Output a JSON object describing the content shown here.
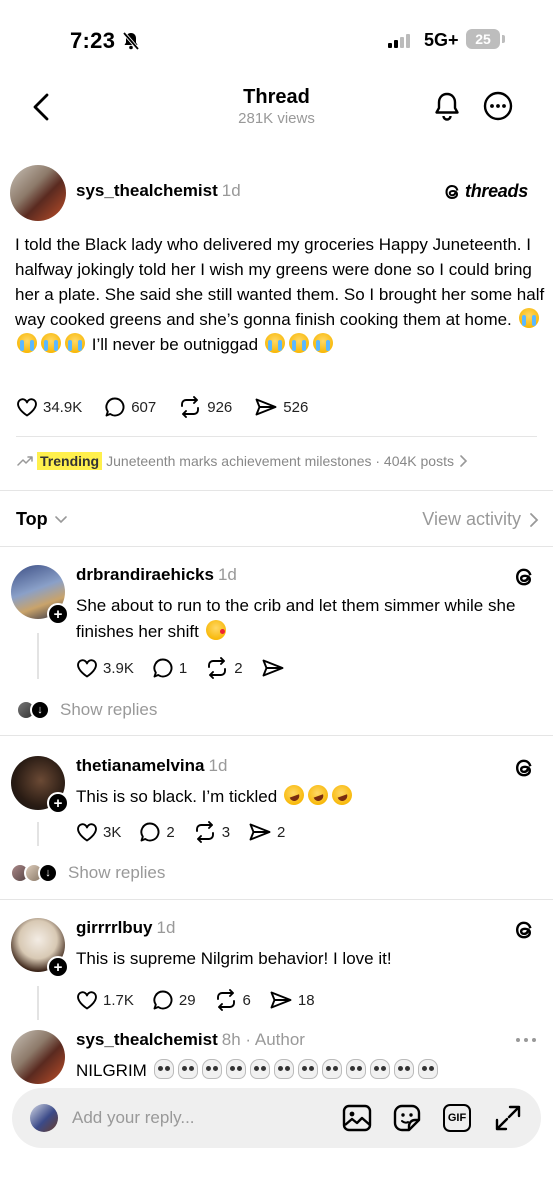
{
  "status_bar": {
    "time": "7:23",
    "network": "5G+",
    "battery": "25"
  },
  "header": {
    "title": "Thread",
    "views": "281K views"
  },
  "post": {
    "username": "sys_thealchemist",
    "age": "1d",
    "brand": "threads",
    "text_1": "I told the Black lady who delivered my groceries Happy Juneteenth. I halfway jokingly told her I wish my greens were done so I could bring her a plate. She said she still wanted them. So I brought her some half way cooked greens and she’s gonna finish cooking them at home.",
    "text_2": "I’ll never be outniggad",
    "likes": "34.9K",
    "comments": "607",
    "reposts": "926",
    "shares": "526"
  },
  "trending": {
    "tag": "Trending",
    "text": "Juneteenth marks achievement milestones · 404K posts"
  },
  "sort": {
    "label": "Top",
    "view_activity": "View activity"
  },
  "replies": [
    {
      "username": "drbrandiraehicks",
      "age": "1d",
      "text": "She about to run to the crib and let them simmer while she finishes her shift",
      "likes": "3.9K",
      "comments": "1",
      "reposts": "2",
      "show_replies": "Show replies"
    },
    {
      "username": "thetianamelvina",
      "age": "1d",
      "text": "This is so black. I’m tickled",
      "likes": "3K",
      "comments": "2",
      "reposts": "3",
      "shares": "2",
      "show_replies": "Show replies"
    },
    {
      "username": "girrrrlbuy",
      "age": "1d",
      "text": "This is supreme Nilgrim behavior! I love it!",
      "likes": "1.7K",
      "comments": "29",
      "reposts": "6",
      "shares": "18"
    },
    {
      "username": "sys_thealchemist",
      "age": "8h",
      "author_tag": "· Author",
      "text": "NILGRIM"
    }
  ],
  "composer": {
    "placeholder": "Add your reply...",
    "gif_label": "GIF"
  }
}
